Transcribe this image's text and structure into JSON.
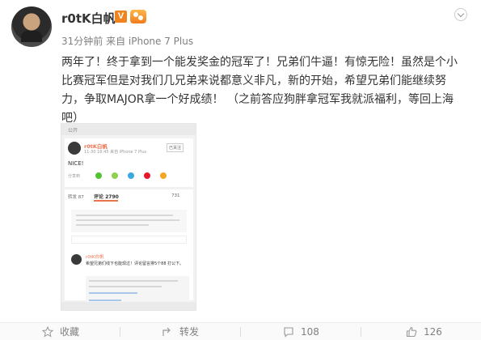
{
  "post": {
    "username": "r0tK白帆",
    "verified_badge": "V",
    "meta": "31分钟前  来自 iPhone 7 Plus",
    "text_lines": [
      "两年了！终于拿到一个能发奖金的冠军了！兄弟们牛逼！有惊无险！虽然是个小",
      "比赛冠军但是对我们几兄弟来说都意义非凡，新的开始，希望兄弟们能继续努",
      "力，争取MAJOR拿一个好成绩！ （之前答应狗胖拿冠军我就派福利，等回上海",
      "吧）"
    ],
    "accent_color": "#eb7350"
  },
  "image": {
    "public_label": "公开",
    "name": "r0tK白帆",
    "meta": "11-30 16:45 来自 iPhone 7 Plus",
    "follow_label": "已关注",
    "content": "NICE!",
    "share_label": "分享到",
    "forward_label": "转发 87",
    "comment_label": "评论 2790",
    "like_label": "731",
    "comment_name": "r0tK白帆",
    "comment_text": "希望兄弟们线下也能现过！评论留言排5个88 打公下。",
    "icons": [
      "wechat-icon",
      "moments-icon",
      "qq-icon",
      "weibo-icon",
      "collection-icon"
    ]
  },
  "footer": {
    "favorite_label": "收藏",
    "repost_label": "转发",
    "comment_count": "108",
    "like_count": "126"
  }
}
